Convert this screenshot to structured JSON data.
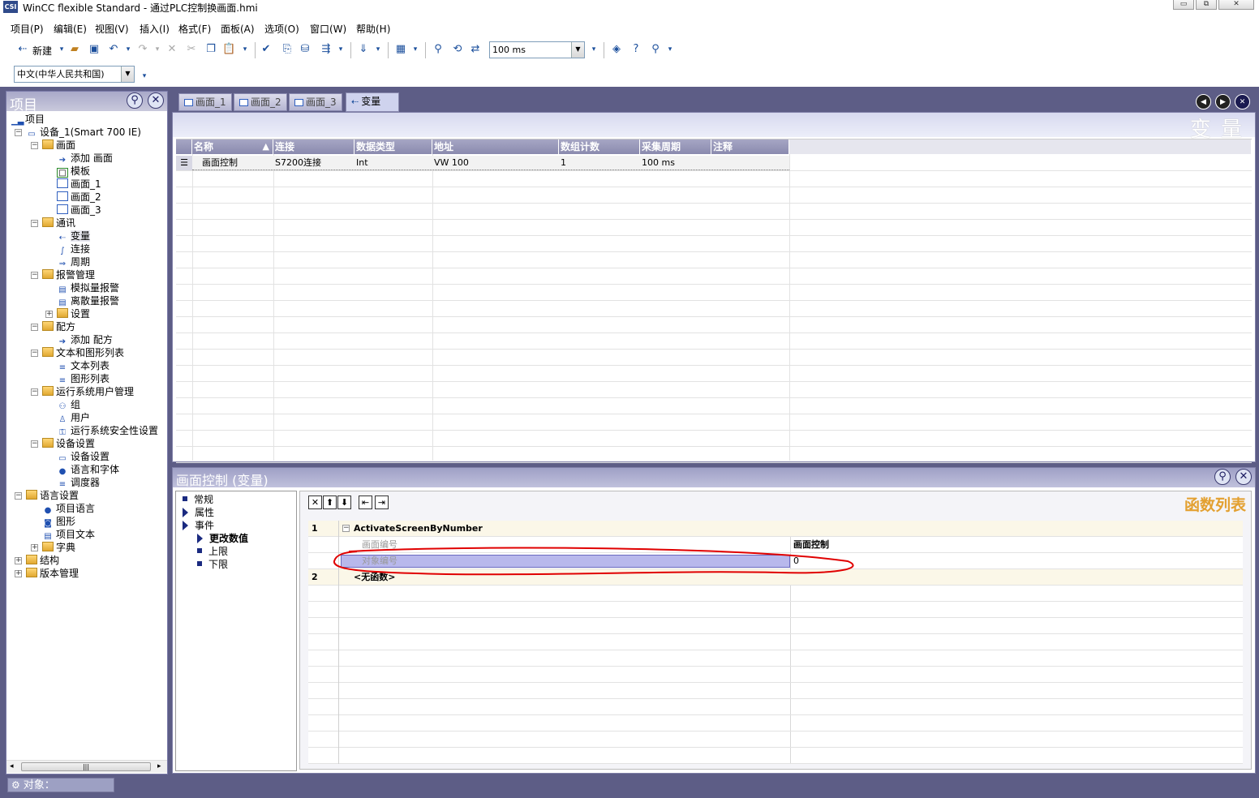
{
  "window": {
    "title": "WinCC flexible Standard - 通过PLC控制换画面.hmi",
    "app_icon": "CSI",
    "buttons": {
      "minimize": "▭",
      "restore": "⧉",
      "close": "✕"
    }
  },
  "menu": [
    "项目(P)",
    "编辑(E)",
    "视图(V)",
    "插入(I)",
    "格式(F)",
    "面板(A)",
    "选项(O)",
    "窗口(W)",
    "帮助(H)"
  ],
  "toolbar": {
    "new_label": "新建",
    "cycle_value": "100 ms",
    "language_value": "中文(中华人民共和国)"
  },
  "project_panel": {
    "title": "项目",
    "tree": [
      {
        "label": "项目",
        "level": 0,
        "icon": "chart-icon"
      },
      {
        "label": "设备_1(Smart 700 IE)",
        "level": 1,
        "icon": "device-icon",
        "expander": "−"
      },
      {
        "label": "画面",
        "level": 2,
        "icon": "folder-icon",
        "expander": "−"
      },
      {
        "label": "添加 画面",
        "level": 3,
        "icon": "add-icon"
      },
      {
        "label": "模板",
        "level": 3,
        "icon": "template-icon"
      },
      {
        "label": "画面_1",
        "level": 3,
        "icon": "screen-icon"
      },
      {
        "label": "画面_2",
        "level": 3,
        "icon": "screen-icon"
      },
      {
        "label": "画面_3",
        "level": 3,
        "icon": "screen-icon"
      },
      {
        "label": "通讯",
        "level": 2,
        "icon": "folder-icon",
        "expander": "−"
      },
      {
        "label": "变量",
        "level": 3,
        "icon": "tag-icon"
      },
      {
        "label": "连接",
        "level": 3,
        "icon": "connection-icon"
      },
      {
        "label": "周期",
        "level": 3,
        "icon": "cycle-icon"
      },
      {
        "label": "报警管理",
        "level": 2,
        "icon": "folder-icon",
        "expander": "−"
      },
      {
        "label": "模拟量报警",
        "level": 3,
        "icon": "alarm-icon"
      },
      {
        "label": "离散量报警",
        "level": 3,
        "icon": "alarm-icon"
      },
      {
        "label": "设置",
        "level": 3,
        "icon": "folder-icon",
        "expander": "+"
      },
      {
        "label": "配方",
        "level": 2,
        "icon": "folder-icon",
        "expander": "−"
      },
      {
        "label": "添加 配方",
        "level": 3,
        "icon": "add-icon"
      },
      {
        "label": "文本和图形列表",
        "level": 2,
        "icon": "folder-icon",
        "expander": "−"
      },
      {
        "label": "文本列表",
        "level": 3,
        "icon": "list-icon"
      },
      {
        "label": "图形列表",
        "level": 3,
        "icon": "list-icon"
      },
      {
        "label": "运行系统用户管理",
        "level": 2,
        "icon": "folder-icon",
        "expander": "−"
      },
      {
        "label": "组",
        "level": 3,
        "icon": "group-icon"
      },
      {
        "label": "用户",
        "level": 3,
        "icon": "user-icon"
      },
      {
        "label": "运行系统安全性设置",
        "level": 3,
        "icon": "security-icon"
      },
      {
        "label": "设备设置",
        "level": 2,
        "icon": "folder-icon",
        "expander": "−"
      },
      {
        "label": "设备设置",
        "level": 3,
        "icon": "settings-icon"
      },
      {
        "label": "语言和字体",
        "level": 3,
        "icon": "globe-icon"
      },
      {
        "label": "调度器",
        "level": 3,
        "icon": "scheduler-icon"
      },
      {
        "label": "语言设置",
        "level": 1,
        "icon": "folder-icon",
        "expander": "−"
      },
      {
        "label": "项目语言",
        "level": 2,
        "icon": "globe-icon"
      },
      {
        "label": "图形",
        "level": 2,
        "icon": "graphic-icon"
      },
      {
        "label": "项目文本",
        "level": 2,
        "icon": "text-icon"
      },
      {
        "label": "字典",
        "level": 2,
        "icon": "folder-icon",
        "expander": "+"
      },
      {
        "label": "结构",
        "level": 1,
        "icon": "folder-icon",
        "expander": "+"
      },
      {
        "label": "版本管理",
        "level": 1,
        "icon": "folder-icon",
        "expander": "+"
      }
    ]
  },
  "editor_tabs": [
    {
      "label": "画面_1",
      "active": false
    },
    {
      "label": "画面_2",
      "active": false
    },
    {
      "label": "画面_3",
      "active": false
    },
    {
      "label": "变量",
      "active": true
    }
  ],
  "tag_editor": {
    "title": "变 量",
    "columns": [
      "名称",
      "连接",
      "数据类型",
      "地址",
      "数组计数",
      "采集周期",
      "注释"
    ],
    "rows": [
      [
        "画面控制",
        "S7200连接",
        "Int",
        "VW 100",
        "1",
        "100 ms",
        ""
      ]
    ]
  },
  "property_panel": {
    "title": "画面控制 (变量)",
    "nav": [
      {
        "label": "常规",
        "bullet": "square",
        "level": 0
      },
      {
        "label": "属性",
        "bullet": "triangle",
        "level": 0
      },
      {
        "label": "事件",
        "bullet": "triangle",
        "level": 0
      },
      {
        "label": "更改数值",
        "bullet": "arrow",
        "level": 1,
        "bold": true
      },
      {
        "label": "上限",
        "bullet": "square",
        "level": 1
      },
      {
        "label": "下限",
        "bullet": "square",
        "level": 1
      }
    ],
    "function_list": {
      "title": "函数列表",
      "toolbar": [
        "✕",
        "⬆",
        "⬇",
        "⇤",
        "⇥"
      ],
      "rows": [
        {
          "num": "1",
          "name": "ActivateScreenByNumber",
          "value": "",
          "expander": "−"
        },
        {
          "num": "",
          "name": "画面编号",
          "value": "画面控制"
        },
        {
          "num": "",
          "name": "对象编号",
          "value": "0"
        },
        {
          "num": "2",
          "name": "<无函数>",
          "value": ""
        }
      ]
    }
  },
  "status": {
    "object_label": "对象："
  },
  "colors": {
    "accent_orange": "#e3a030",
    "panel_purple": "#5d5d86",
    "annotation_red": "#e00000"
  }
}
